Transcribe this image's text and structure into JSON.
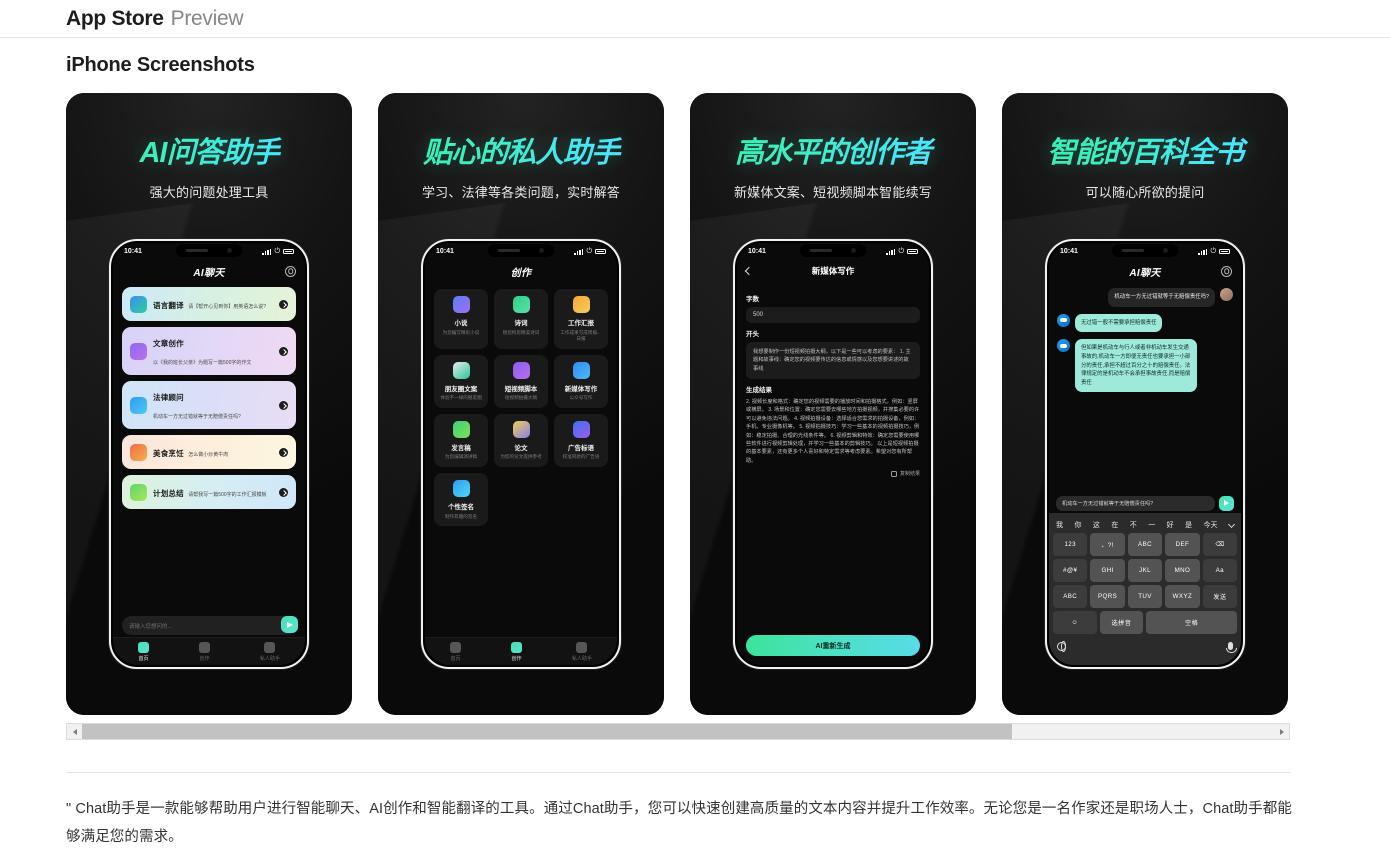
{
  "header": {
    "brand": "App Store",
    "preview": "Preview"
  },
  "section": {
    "title": "iPhone Screenshots"
  },
  "status": {
    "clock": "10:41"
  },
  "scrollbar": {
    "left_arrow": "◀",
    "right_arrow": "▶"
  },
  "description": "\" Chat助手是一款能够帮助用户进行智能聊天、AI创作和智能翻译的工具。通过Chat助手，您可以快速创建高质量的文本内容并提升工作效率。无论您是一名作家还是职场人士，Chat助手都能够满足您的需求。",
  "screenshots": [
    {
      "hero_title": "AI问答助手",
      "hero_sub": "强大的问题处理工具",
      "nav_title": "AI聊天",
      "gear_icon": "gear-icon",
      "cards": [
        {
          "title": "语言翻译",
          "sub": "请【帮开心见到你】用英语怎么说?",
          "icon": "translate-icon"
        },
        {
          "title": "文章创作",
          "sub": "以《我的班长父亲》为题写一篇500字的作文",
          "icon": "article-icon"
        },
        {
          "title": "法律顾问",
          "sub": "机动车一方无过错就等于无赔偿责任吗?",
          "icon": "law-icon"
        },
        {
          "title": "美食烹饪",
          "sub": "怎么做小炒黄牛肉",
          "icon": "food-icon"
        },
        {
          "title": "计划总结",
          "sub": "请帮我写一篇500字的工作汇报模板",
          "icon": "plan-icon"
        }
      ],
      "input_placeholder": "请输入您想问的...",
      "send_icon": "send-icon",
      "tabs": [
        {
          "label": "首页",
          "icon": "home-icon",
          "active": true
        },
        {
          "label": "创作",
          "icon": "create-icon",
          "active": false
        },
        {
          "label": "私人助手",
          "icon": "assistant-icon",
          "active": false
        }
      ]
    },
    {
      "hero_title": "贴心的私人助手",
      "hero_sub": "学习、法律等各类问题，实时解答",
      "nav_title": "创作",
      "grid": [
        {
          "title": "小说",
          "sub": "为您编写精彩小说",
          "icon": "novel-icon"
        },
        {
          "title": "诗词",
          "sub": "替您构思精美诗词",
          "icon": "poem-icon"
        },
        {
          "title": "工作汇报",
          "sub": "工作成果写成周报、日报",
          "icon": "report-icon"
        },
        {
          "title": "朋友圈文案",
          "sub": "体验不一样的朋友圈",
          "icon": "moments-icon"
        },
        {
          "title": "短视频脚本",
          "sub": "短视频拍摄大纲",
          "icon": "video-script-icon"
        },
        {
          "title": "新媒体写作",
          "sub": "公众号写作",
          "icon": "newmedia-icon"
        },
        {
          "title": "发言稿",
          "sub": "为您编辑演讲稿",
          "icon": "speech-icon"
        },
        {
          "title": "论文",
          "sub": "为您的论文提供参考",
          "icon": "thesis-icon"
        },
        {
          "title": "广告标语",
          "sub": "校准同款的广告语",
          "icon": "ad-icon"
        },
        {
          "title": "个性签名",
          "sub": "制作有趣的签名",
          "icon": "signature-icon"
        }
      ],
      "tabs": [
        {
          "label": "首页",
          "icon": "home-icon",
          "active": false
        },
        {
          "label": "创作",
          "icon": "create-icon",
          "active": true
        },
        {
          "label": "私人助手",
          "icon": "assistant-icon",
          "active": false
        }
      ]
    },
    {
      "hero_title": "高水平的创作者",
      "hero_sub": "新媒体文案、短视频脚本智能续写",
      "nav_title": "新媒体写作",
      "back_icon": "back-chevron-icon",
      "field_count_label": "字数",
      "field_count_value": "500",
      "field_open_label": "开头",
      "field_open_value": "我想要制作一份短视频拍摄大纲，以下是一些可以考虑的要素：\n1. 主题和故事线：确定您的视频要传达的信息或情感以及您想要讲述的故事线",
      "result_label": "生成结果",
      "result_text": "2. 视频长度和格式：确定您的视频需要的播放时间和拍摄格式，例如：竖屏或横屏。\n3. 场景和位置：确定您需要去哪些地方拍摄视频，并搜集必要的许可以避免违法问题。\n4. 视频拍摄设备：选择适合您需求的拍摄设备，例如：手机、专业摄像机等。\n5. 视频拍摄技巧：学习一些基本的视频拍摄技巧，例如：稳定拍摄、合理的光线条件等。\n6. 视频剪辑和特效：确定您需要使用哪些软件进行视频剪辑处理，并学习一些基本的剪辑技巧。\n以上是短视频拍摄的基本要素，还有更多个人喜好和特定需求等考虑要素。希望对您有所帮助。",
      "copy_label": "复制结果",
      "copy_icon": "copy-icon",
      "regen_label": "AI重新生成"
    },
    {
      "hero_title": "智能的百科全书",
      "hero_sub": "可以随心所欲的提问",
      "nav_title": "AI聊天",
      "gear_icon": "gear-icon",
      "messages": [
        {
          "from": "user",
          "text": "机动车一方无过错就等于无赔偿责任吗?",
          "avatar": "user-avatar"
        },
        {
          "from": "ai",
          "text": "无过错一般不需要承担赔偿责任",
          "avatar": "bot-avatar"
        },
        {
          "from": "ai",
          "text": "但如果是机动车与行人或者非机动车发生交通事故的,机动车一方即便无责任也要承担一小部分的责任,承担不超过百分之十的赔偿责任。法律规定的是机动车不会承担事故责任,而是赔偿责任",
          "avatar": "bot-avatar"
        }
      ],
      "chat_input_value": "机动车一方无过错就等于无赔偿责任吗?",
      "send_icon": "send-icon",
      "keyboard": {
        "predictions": [
          "我",
          "你",
          "这",
          "在",
          "不",
          "一",
          "好",
          "是",
          "今天"
        ],
        "rows": [
          [
            "123",
            "、?!",
            "ABC",
            "DEF",
            "⌫"
          ],
          [
            "#@¥",
            "GHI",
            "JKL",
            "MNO",
            "Aa"
          ],
          [
            "ABC",
            "PQRS",
            "TUV",
            "WXYZ",
            "发送"
          ],
          [
            "☺",
            "选拼音",
            "空格"
          ]
        ],
        "globe_icon": "globe-icon",
        "mic_icon": "mic-icon"
      }
    }
  ]
}
